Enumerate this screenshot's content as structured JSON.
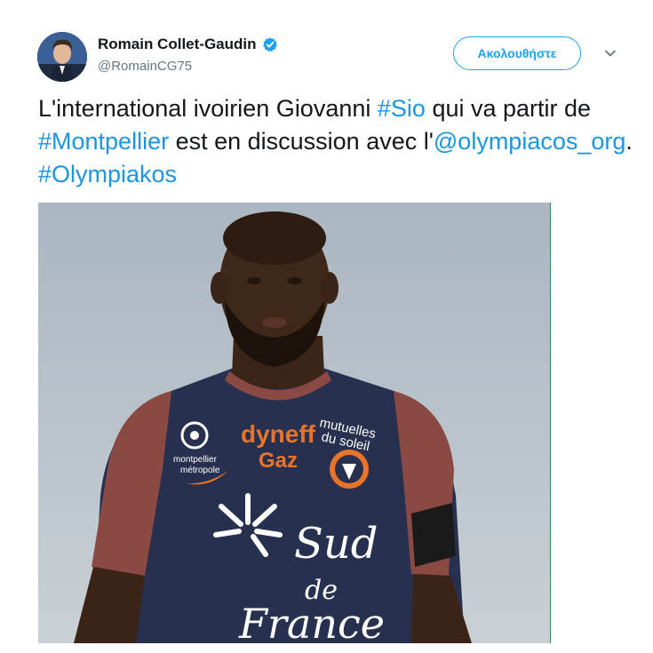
{
  "author": {
    "display_name": "Romain Collet-Gaudin",
    "handle": "@RomainCG75",
    "verified": true,
    "avatar_icon": "user-avatar"
  },
  "follow_button": {
    "label": "Ακολουθήστε"
  },
  "menu_icon": "chevron-down-icon",
  "tweet": {
    "t1": "L'international ivoirien Giovanni ",
    "h1": "#Sio",
    "t2": " qui va partir de ",
    "h2": "#Montpellier",
    "t3": " est en discussion avec l'",
    "m1": "@olympiacos_org",
    "t4": ". ",
    "h3": "#Olympiakos"
  },
  "media": {
    "sponsor_main": "dyneff",
    "sponsor_sub": "Gaz",
    "sponsor_right_1": "mutuelles",
    "sponsor_right_2": "du soleil",
    "sponsor_left_1": "montpellier",
    "sponsor_left_2": "métropole",
    "shirt_text_1": "Sud",
    "shirt_text_2": "de",
    "shirt_text_3": "France",
    "colors": {
      "shirt_navy": "#27314f",
      "shirt_sleeve": "#8a4a43",
      "sky": "#b9c4cd",
      "accent_orange": "#e8742a"
    }
  },
  "colors": {
    "link": "#1b95e0",
    "follow": "#1da1f2",
    "handle": "#657786"
  }
}
